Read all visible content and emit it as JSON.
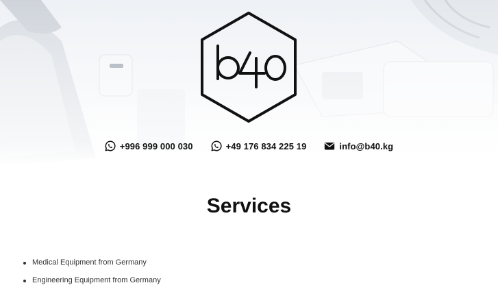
{
  "brand": {
    "logo_text": "b40"
  },
  "contacts": [
    {
      "icon": "whatsapp-icon",
      "text": "+996 999 000 030"
    },
    {
      "icon": "whatsapp-icon",
      "text": "+49 176 834 225 19"
    },
    {
      "icon": "envelope-icon",
      "text": "info@b40.kg"
    }
  ],
  "services": {
    "title": "Services",
    "items": [
      "Medical Equipment from Germany",
      "Engineering Equipment from Germany"
    ]
  },
  "colors": {
    "text": "#111111",
    "hero_background": "#eef1f5"
  }
}
